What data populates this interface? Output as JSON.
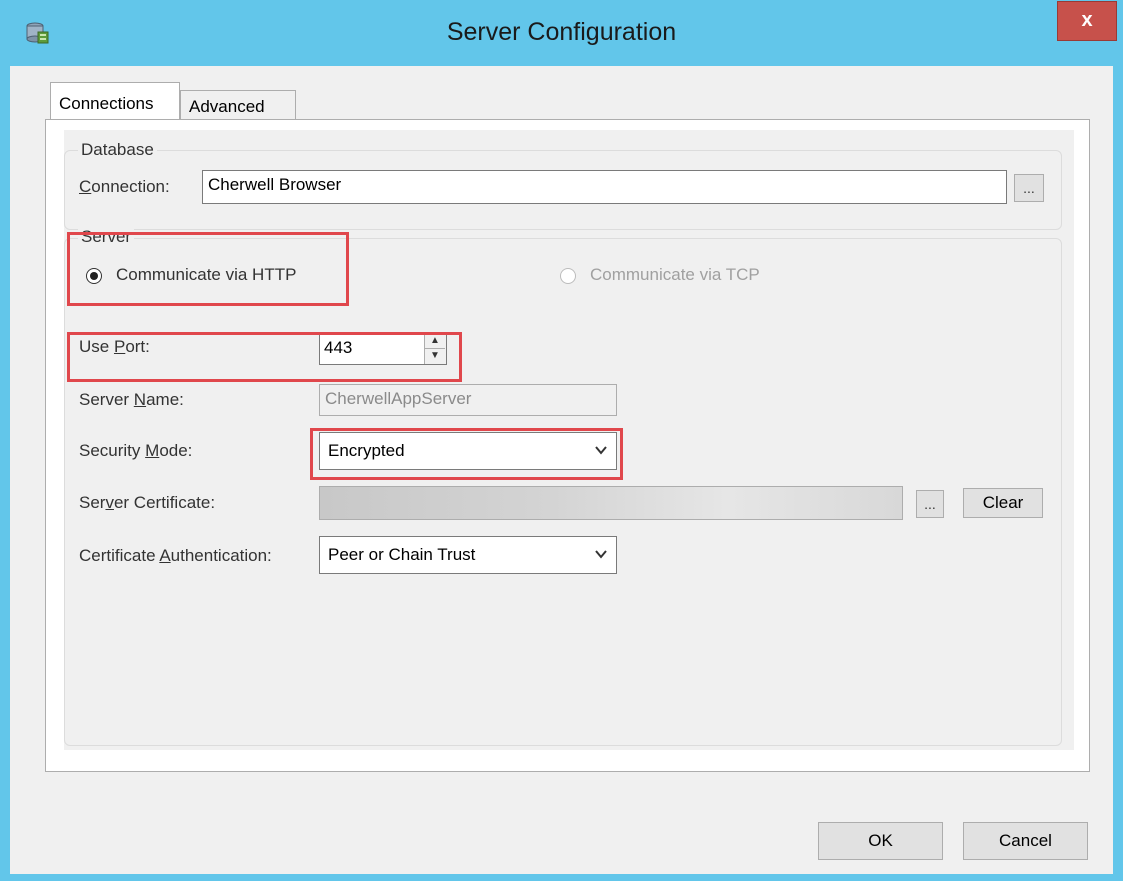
{
  "window": {
    "title": "Server Configuration",
    "close_label": "x",
    "app_icon": "database-server-icon"
  },
  "tabs": [
    {
      "label": "Connections",
      "active": true
    },
    {
      "label": "Advanced",
      "active": false
    }
  ],
  "database": {
    "group_label": "Database",
    "connection_label_underlined": "C",
    "connection_label_rest": "onnection:",
    "connection_value": "Cherwell Browser",
    "browse_label": "..."
  },
  "server": {
    "group_label": "Server",
    "http_label": "Communicate via HTTP",
    "tcp_label": "Communicate via TCP",
    "selected": "http",
    "port_label_a": "Use ",
    "port_label_u": "P",
    "port_label_b": "ort:",
    "port_value": "443",
    "name_label_a": "Server ",
    "name_label_u": "N",
    "name_label_b": "ame:",
    "name_value": "CherwellAppServer",
    "security_label_a": "Security ",
    "security_label_u": "M",
    "security_label_b": "ode:",
    "security_value": "Encrypted",
    "cert_label_a": "Ser",
    "cert_label_u": "v",
    "cert_label_b": "er Certificate:",
    "cert_browse_label": "...",
    "cert_clear_label": "Clear",
    "auth_label_a": "Certificate ",
    "auth_label_u": "A",
    "auth_label_b": "uthentication:",
    "auth_value": "Peer or Chain Trust"
  },
  "footer": {
    "ok_label": "OK",
    "cancel_label": "Cancel"
  },
  "colors": {
    "title_bar": "#62c6ea",
    "close_button": "#c7514b",
    "highlight": "#e0474c"
  }
}
